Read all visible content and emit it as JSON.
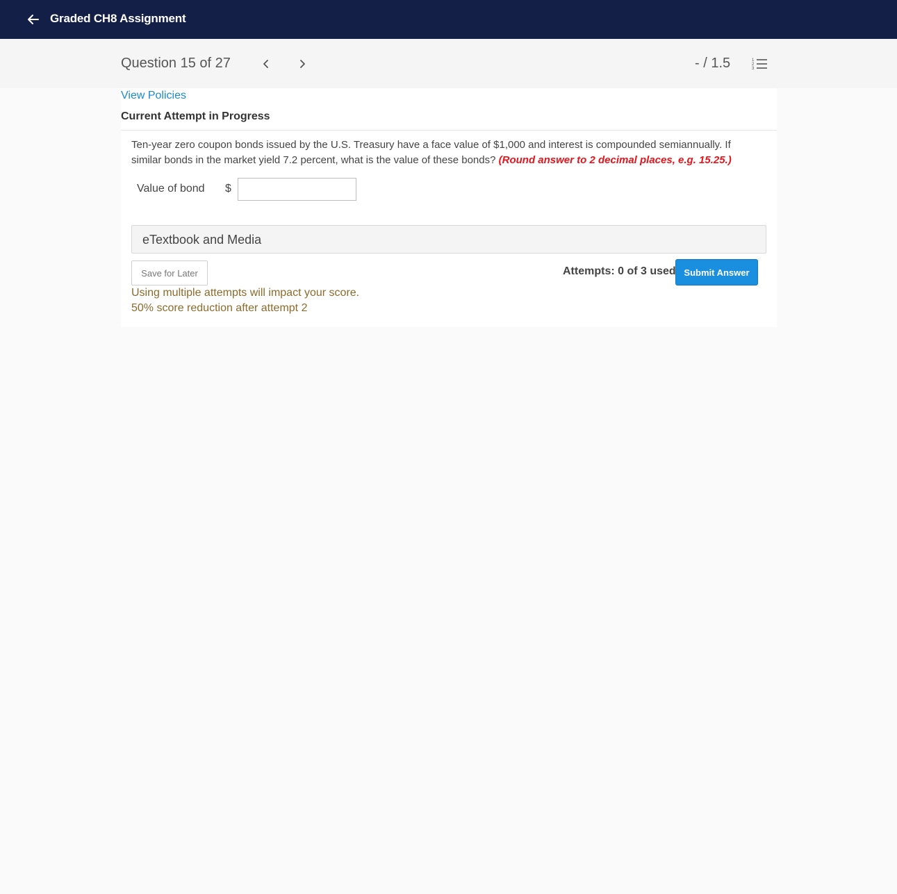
{
  "topbar": {
    "back_icon": "arrow-left-icon",
    "title": "Graded CH8 Assignment",
    "bg_color": "#131f47"
  },
  "question_header": {
    "label": "Question 15 of 27",
    "prev_icon": "chevron-left-icon",
    "next_icon": "chevron-right-icon",
    "score": "- / 1.5",
    "list_icon": "numbered-list-icon"
  },
  "card": {
    "policies_link": "View Policies",
    "attempt_heading": "Current Attempt in Progress",
    "question_text": "Ten-year zero coupon bonds issued by the U.S. Treasury have a face value of $1,000 and interest is compounded semiannually. If similar bonds in the market yield 7.2 percent, what is the value of these bonds? ",
    "question_hint": "(Round answer to 2 decimal places, e.g. 15.25.)",
    "hint_color": "#e8131b",
    "value_label": "Value of bond",
    "currency_symbol": "$",
    "value_input": "",
    "etextbook_label": "eTextbook and Media",
    "save_label": "Save for Later",
    "attempts_prefix": "Attempts: 0 of 3 used",
    "submit_label": "Submit Answer",
    "submit_color": "#1a8fe0",
    "warning_line1": "Using multiple attempts will impact your score.",
    "warning_line2": "50% score reduction after attempt 2",
    "warning_color": "#8c6a2c"
  }
}
